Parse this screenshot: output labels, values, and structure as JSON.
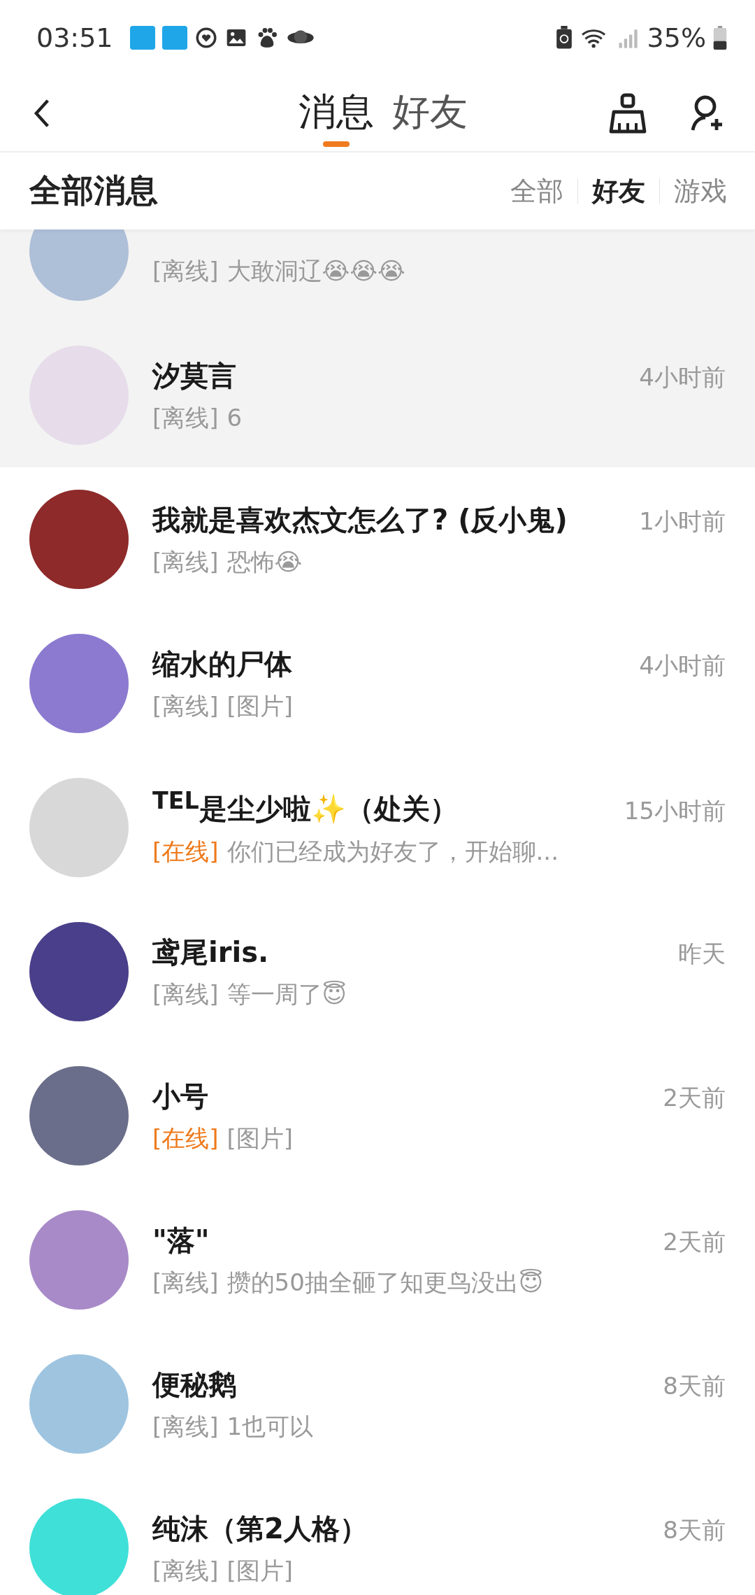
{
  "status_bar": {
    "time": "03:51",
    "battery": "35%"
  },
  "header": {
    "tabs": [
      {
        "label": "消息",
        "selected": true
      },
      {
        "label": "好友",
        "selected": false
      }
    ]
  },
  "section": {
    "title": "全部消息",
    "filters": [
      {
        "label": "全部",
        "selected": false
      },
      {
        "label": "好友",
        "selected": true
      },
      {
        "label": "游戏",
        "selected": false
      }
    ]
  },
  "conversations": [
    {
      "status": "[离线]",
      "online": false,
      "preview": "大敢洞辽😭😭😭",
      "pinned": true,
      "color": "#aebfd8"
    },
    {
      "name": "汐莫言",
      "time": "4小时前",
      "status": "[离线]",
      "online": false,
      "preview": "6",
      "pinned": true,
      "color": "#e6dcea"
    },
    {
      "name": "我就是喜欢杰文怎么了? (反小鬼)",
      "time": "1小时前",
      "status": "[离线]",
      "online": false,
      "preview": "恐怖😭",
      "pinned": false,
      "color": "#8e2a2a"
    },
    {
      "name": "缩水的尸体",
      "time": "4小时前",
      "status": "[离线]",
      "online": false,
      "preview": "[图片]",
      "pinned": false,
      "color": "#8c7ad0"
    },
    {
      "name": "$^{TEL}$是尘少啦✨（处关）",
      "time": "15小时前",
      "status": "[在线]",
      "online": true,
      "preview": "你们已经成为好友了，开始聊...",
      "pinned": false,
      "color": "#d8d8d8"
    },
    {
      "name": "鸢尾iris.",
      "time": "昨天",
      "status": "[离线]",
      "online": false,
      "preview": "等一周了😇",
      "pinned": false,
      "color": "#4a3f8a"
    },
    {
      "name": "小号",
      "time": "2天前",
      "status": "[在线]",
      "online": true,
      "preview": "[图片]",
      "pinned": false,
      "color": "#6a6e8a"
    },
    {
      "name": "\"落\"",
      "time": "2天前",
      "status": "[离线]",
      "online": false,
      "preview": "攒的50抽全砸了知更鸟没出😇",
      "pinned": false,
      "color": "#a88ac8"
    },
    {
      "name": "便秘鹅",
      "time": "8天前",
      "status": "[离线]",
      "online": false,
      "preview": "1也可以",
      "pinned": false,
      "color": "#9ec4e0"
    },
    {
      "name": "纯沫（第2人格）",
      "time": "8天前",
      "status": "[离线]",
      "online": false,
      "preview": "[图片]",
      "pinned": false,
      "color": "#3fe0d8"
    }
  ]
}
